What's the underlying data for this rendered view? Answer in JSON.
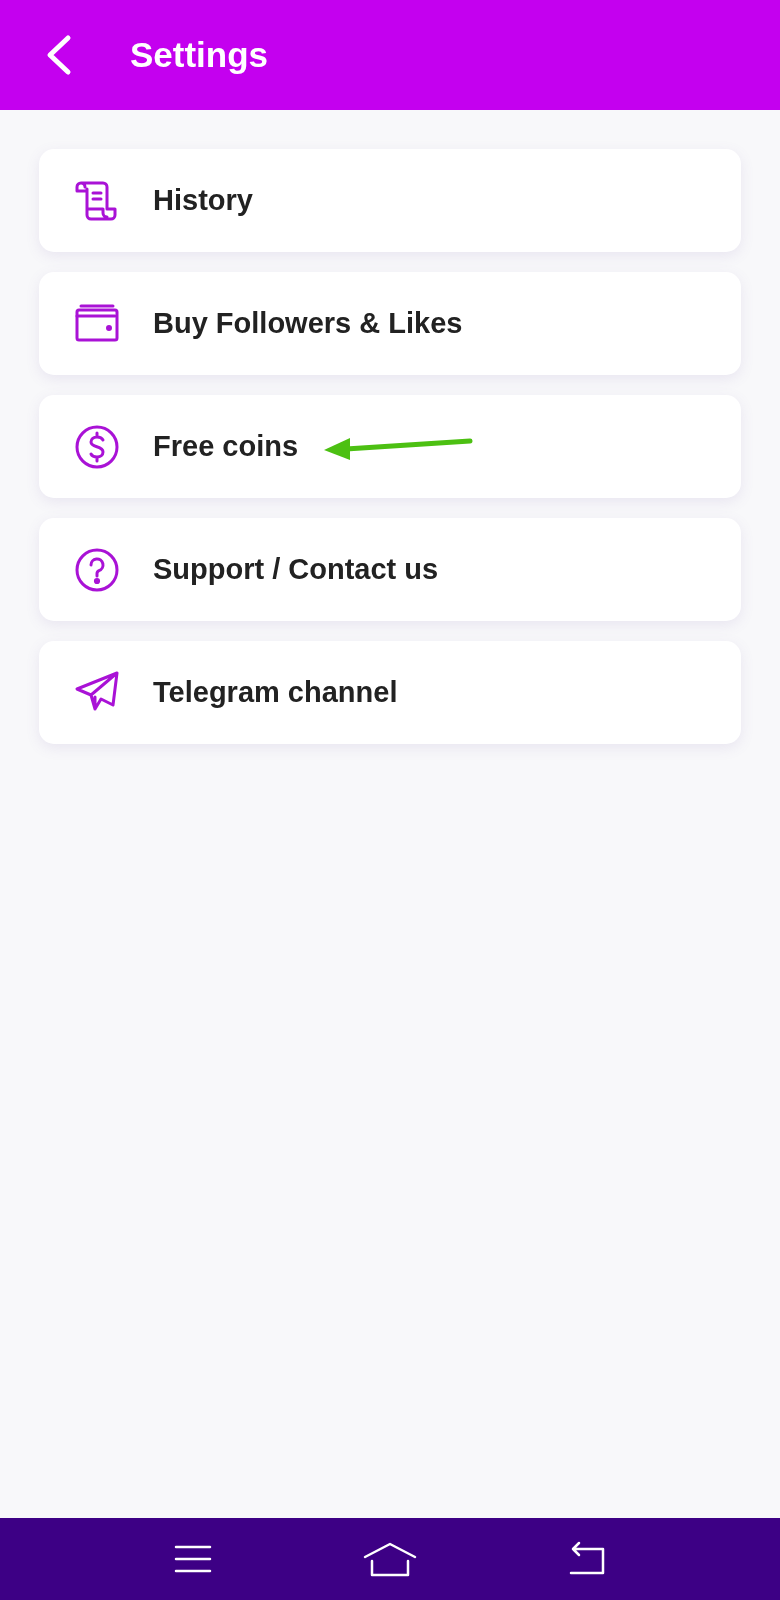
{
  "app_bar": {
    "title": "Settings"
  },
  "items": [
    {
      "label": "History",
      "kind": "scroll",
      "pointed": false
    },
    {
      "label": "Buy Followers & Likes",
      "kind": "wallet",
      "pointed": false
    },
    {
      "label": "Free coins",
      "kind": "coin",
      "pointed": true
    },
    {
      "label": "Support / Contact us",
      "kind": "question",
      "pointed": false
    },
    {
      "label": "Telegram channel",
      "kind": "plane",
      "pointed": false
    }
  ]
}
